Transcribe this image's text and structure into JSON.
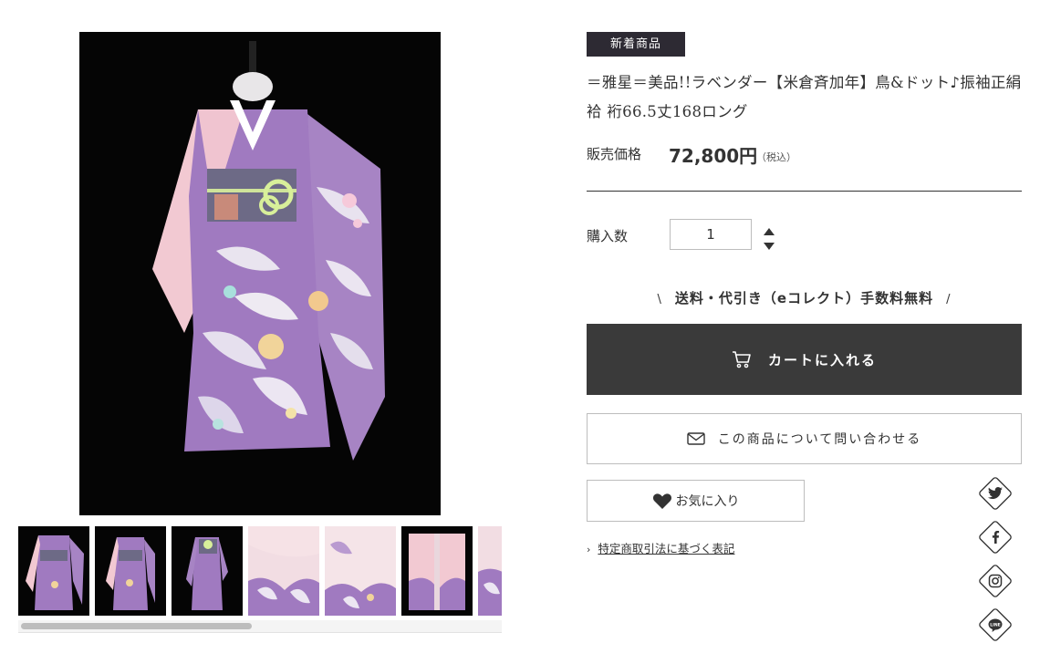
{
  "product": {
    "badge": "新着商品",
    "title": "＝雅星＝美品!!ラベンダー【米倉斉加年】鳥&ドット♪振袖正絹袷 裄66.5丈168ロング",
    "price_label": "販売価格",
    "price": "72,800円",
    "price_tax": "（税込）"
  },
  "quantity": {
    "label": "購入数",
    "value": "1"
  },
  "shipping": {
    "left_mark": "\\",
    "text": "送料・代引き（eコレクト）手数料無料",
    "right_mark": "/"
  },
  "actions": {
    "cart_label": "カートに入れる",
    "inquiry_label": "この商品について問い合わせる",
    "favorite_label": "お気に入り"
  },
  "links": {
    "law_notice": "特定商取引法に基づく表記"
  },
  "gallery": {
    "thumbnail_count_visible": 7,
    "scroll_fraction": 0.48
  },
  "social": [
    "twitter-icon",
    "facebook-icon",
    "instagram-icon",
    "line-icon"
  ],
  "colors": {
    "badge_bg": "#2d2a33",
    "cart_button_bg": "#3a3a3a",
    "kimono_lavender": "#a07ac0",
    "kimono_pink": "#f2c9d2"
  }
}
